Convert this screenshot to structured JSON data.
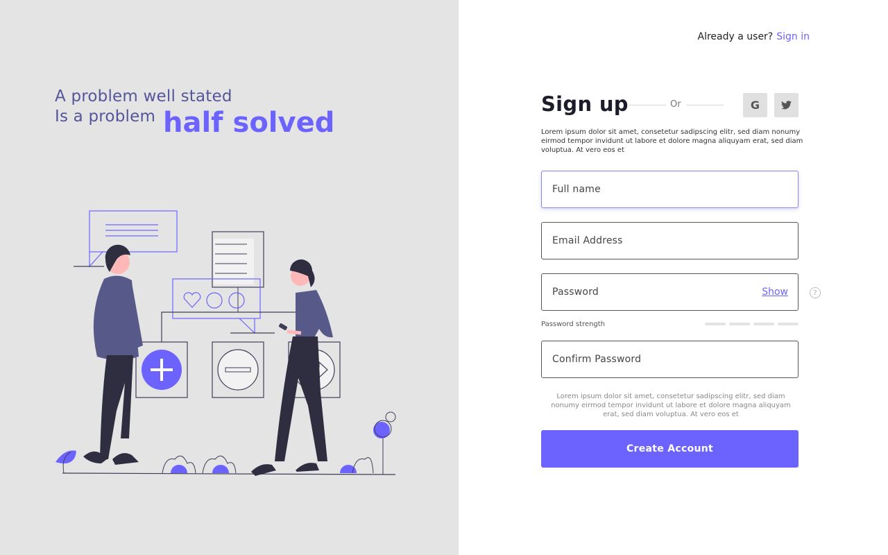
{
  "hero": {
    "line1": "A problem well stated",
    "line2": "Is a problem",
    "emphasis": "half solved"
  },
  "topbar": {
    "prompt": "Already a user?",
    "signin_link": "Sign in"
  },
  "form": {
    "title": "Sign up",
    "or_text": "Or",
    "social": [
      {
        "icon": "google-icon",
        "glyph": "G"
      },
      {
        "icon": "twitter-icon",
        "glyph": "twitter"
      }
    ],
    "description": "Lorem ipsum dolor sit amet, consetetur sadipscing elitr, sed diam nonumy eirmod tempor invidunt ut labore et dolore magna aliquyam erat, sed diam voluptua. At vero eos et",
    "fields": {
      "full_name": {
        "placeholder": "Full name",
        "value": ""
      },
      "email": {
        "placeholder": "Email Address",
        "value": ""
      },
      "password": {
        "placeholder": "Password",
        "value": "",
        "toggle_label": "Show"
      },
      "confirm_password": {
        "placeholder": "Confirm Password",
        "value": ""
      }
    },
    "help_glyph": "?",
    "password_strength_label": "Password strength",
    "password_strength_level": 0,
    "password_strength_segments": 4,
    "terms": "Lorem ipsum dolor sit amet, consetetur sadipscing elitr, sed diam nonumy eirmod tempor invidunt ut labore et dolore magna aliquyam erat, sed diam voluptua. At vero eos et",
    "submit_label": "Create Account"
  },
  "colors": {
    "accent": "#6c63ff",
    "heading_muted": "#55559a",
    "left_panel_bg": "#e4e4e4"
  }
}
